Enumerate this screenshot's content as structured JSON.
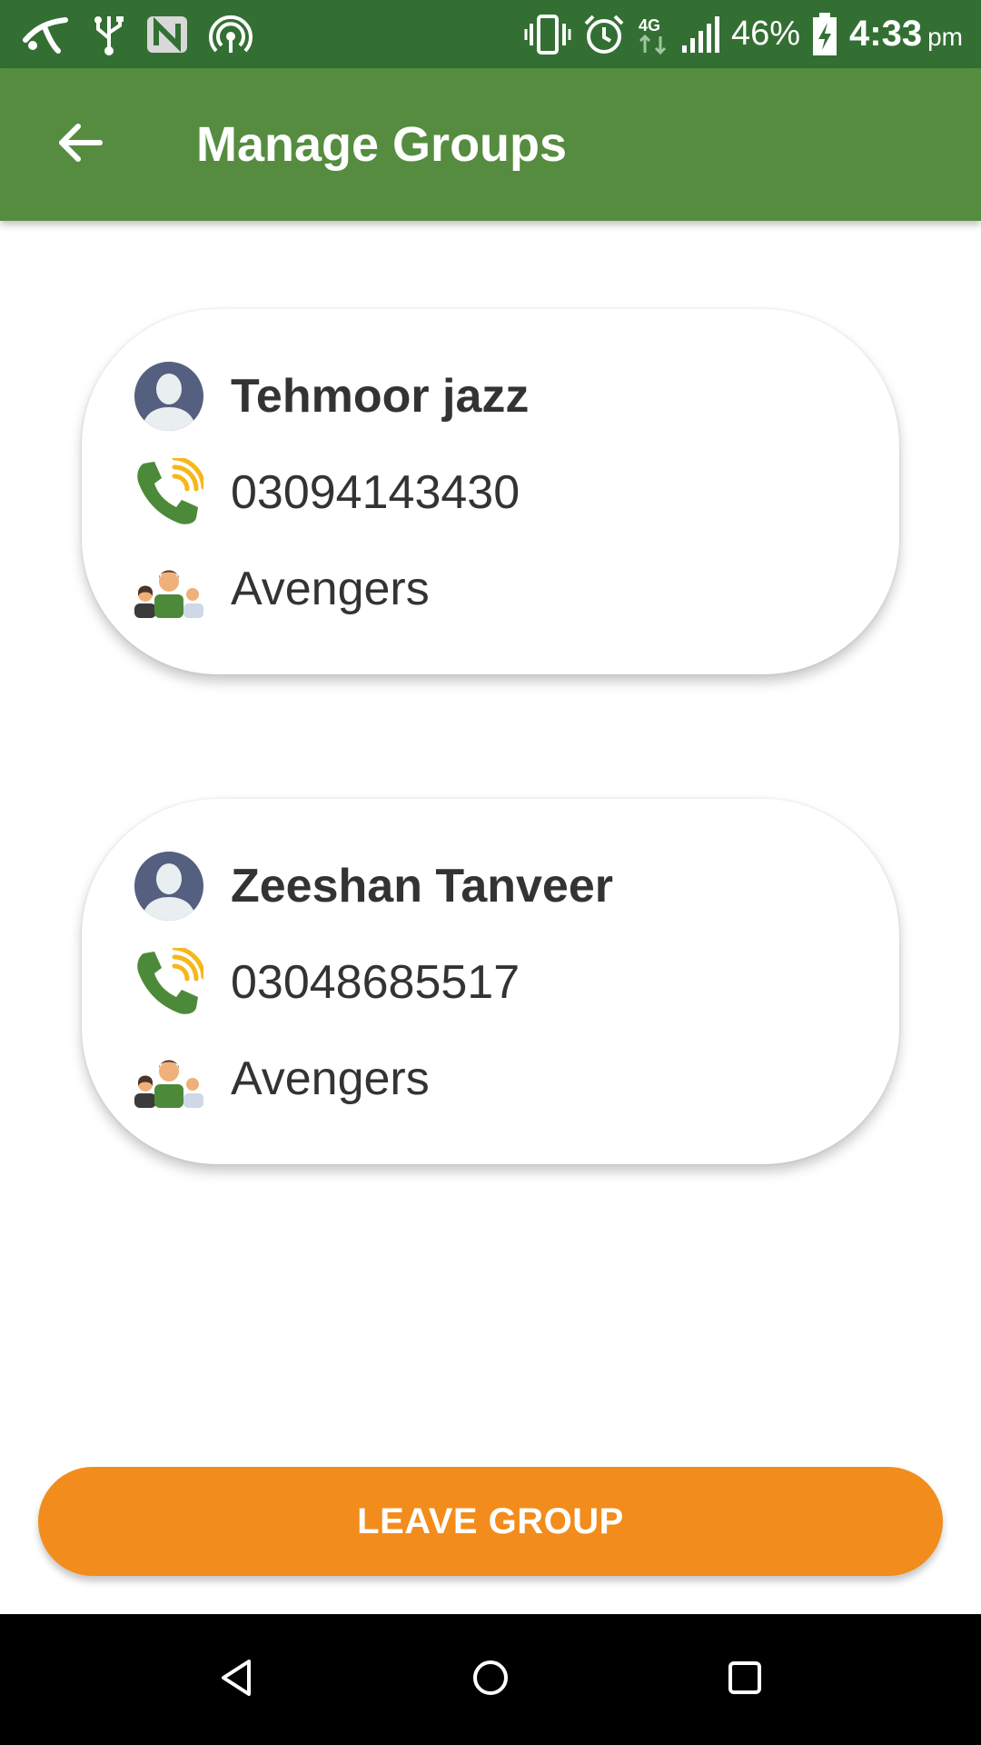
{
  "status_bar": {
    "battery": "46%",
    "time": "4:33",
    "ampm": "pm",
    "icons": [
      "telenor-icon",
      "usb-icon",
      "nfc-icon",
      "hotspot-icon",
      "vibrate-icon",
      "alarm-icon",
      "4g-data-icon",
      "signal-icon",
      "battery-charging-icon"
    ]
  },
  "app_bar": {
    "title": "Manage Groups",
    "back_icon": "arrow-back-icon"
  },
  "members": [
    {
      "name": "Tehmoor jazz",
      "phone": "03094143430",
      "group": "Avengers"
    },
    {
      "name": "Zeeshan Tanveer",
      "phone": "03048685517",
      "group": "Avengers"
    }
  ],
  "leave_button": {
    "label": "LEAVE GROUP"
  },
  "colors": {
    "status_bar": "#336f33",
    "app_bar": "#568c3f",
    "accent": "#f28c1c",
    "text": "#333333"
  },
  "nav_bar": {
    "icons": [
      "back-triangle-icon",
      "home-circle-icon",
      "recents-square-icon"
    ]
  }
}
